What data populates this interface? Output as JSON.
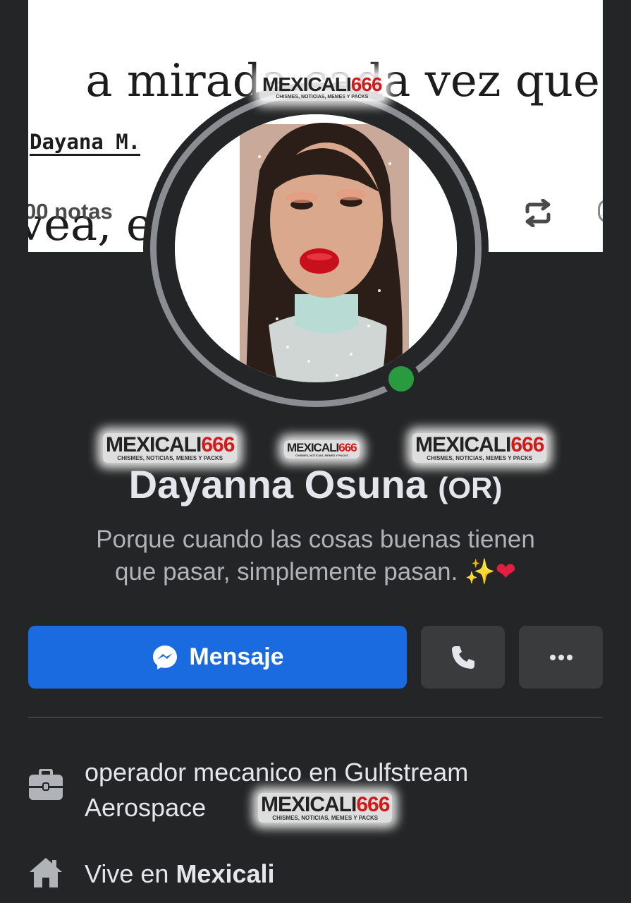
{
  "cover": {
    "quote_line1": "a mirada cada vez que te",
    "quote_line2": "vea, eso te mereces.",
    "author": "Dayana M.",
    "notes": "00 notas"
  },
  "watermark": {
    "brand_a": "MEXICALI",
    "brand_b": "666",
    "tagline": "CHISMES, NOTICIAS, MEMES Y PACKS"
  },
  "profile": {
    "name": "Dayanna Osuna",
    "alt_name": "(OR)",
    "bio_line1": "Porque cuando las cosas buenas tienen",
    "bio_line2": "que pasar, simplemente pasan.",
    "bio_emoji_sparkle": "✨",
    "bio_emoji_heart": "❤",
    "online": true
  },
  "actions": {
    "message_label": "Mensaje"
  },
  "details": {
    "work": "operador mecanico en Gulfstream Aerospace",
    "work_line1": "operador mecanico en Gulfstream",
    "work_line2": "Aerospace",
    "lives_prefix": "Vive en ",
    "lives_city": "Mexicali"
  },
  "colors": {
    "background": "#242526",
    "primary_button": "#1b6be0",
    "secondary_button": "#3a3b3c",
    "online": "#2a9a3e"
  },
  "icons": [
    "messenger-icon",
    "phone-icon",
    "more-icon",
    "briefcase-icon",
    "home-icon",
    "reblog-icon"
  ]
}
